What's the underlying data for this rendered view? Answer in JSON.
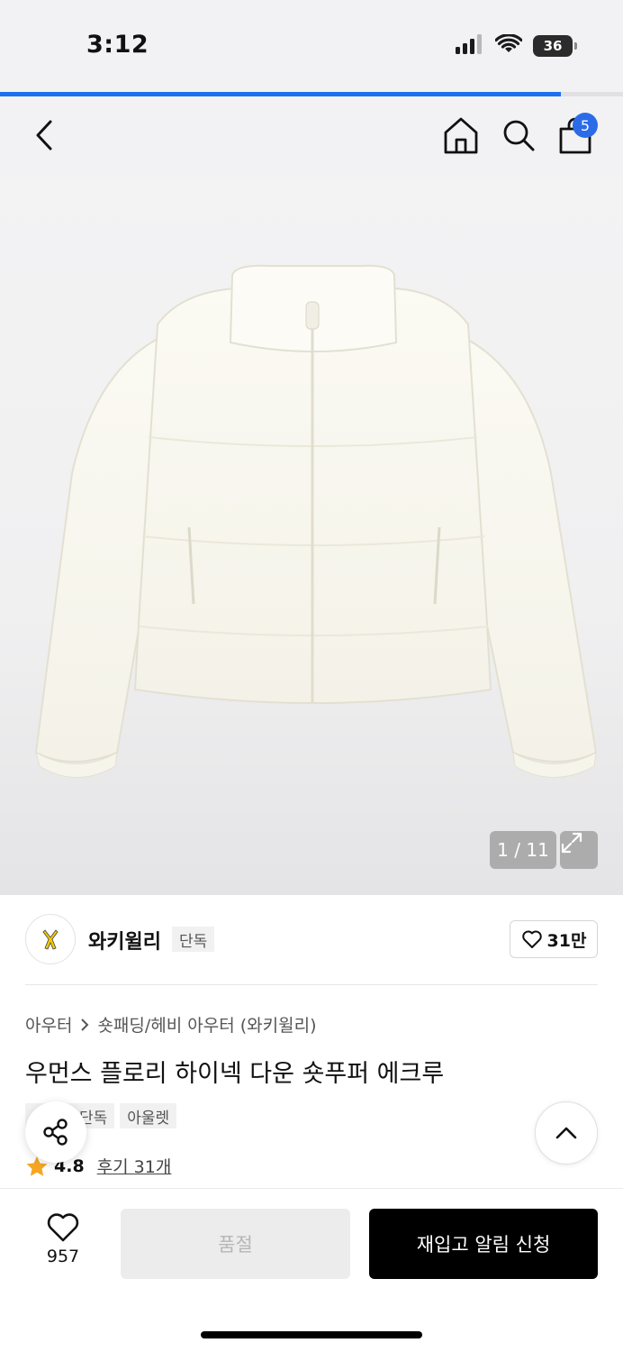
{
  "status_bar": {
    "time": "3:12",
    "battery": "36",
    "icons": [
      "signal-icon",
      "wifi-icon",
      "battery-icon"
    ]
  },
  "page_load_progress": 0.9,
  "nav": {
    "cart_count": "5",
    "icons": [
      "back-icon",
      "home-icon",
      "search-icon",
      "cart-icon"
    ]
  },
  "gallery": {
    "counter": "1 / 11"
  },
  "brand": {
    "name": "와키윌리",
    "badge": "단독",
    "likes": "31만"
  },
  "product": {
    "breadcrumb": [
      "아우터",
      "숏패딩/헤비 아우터 (와키윌리)"
    ],
    "title": "우먼스 플로리 하이넥 다운 숏푸퍼 에크루",
    "tags": [
      "단독",
      "아울렛"
    ],
    "rating": "4.8",
    "review_link": "후기 31개"
  },
  "bottom": {
    "wish_count": "957",
    "soldout_label": "품절",
    "restock_label": "재입고 알림 신청"
  },
  "colors": {
    "accent_blue": "#1e6ff0",
    "badge_blue": "#2b6be8",
    "star": "#f5a623",
    "primary_button": "#000000",
    "disabled_button": "#ececec"
  }
}
